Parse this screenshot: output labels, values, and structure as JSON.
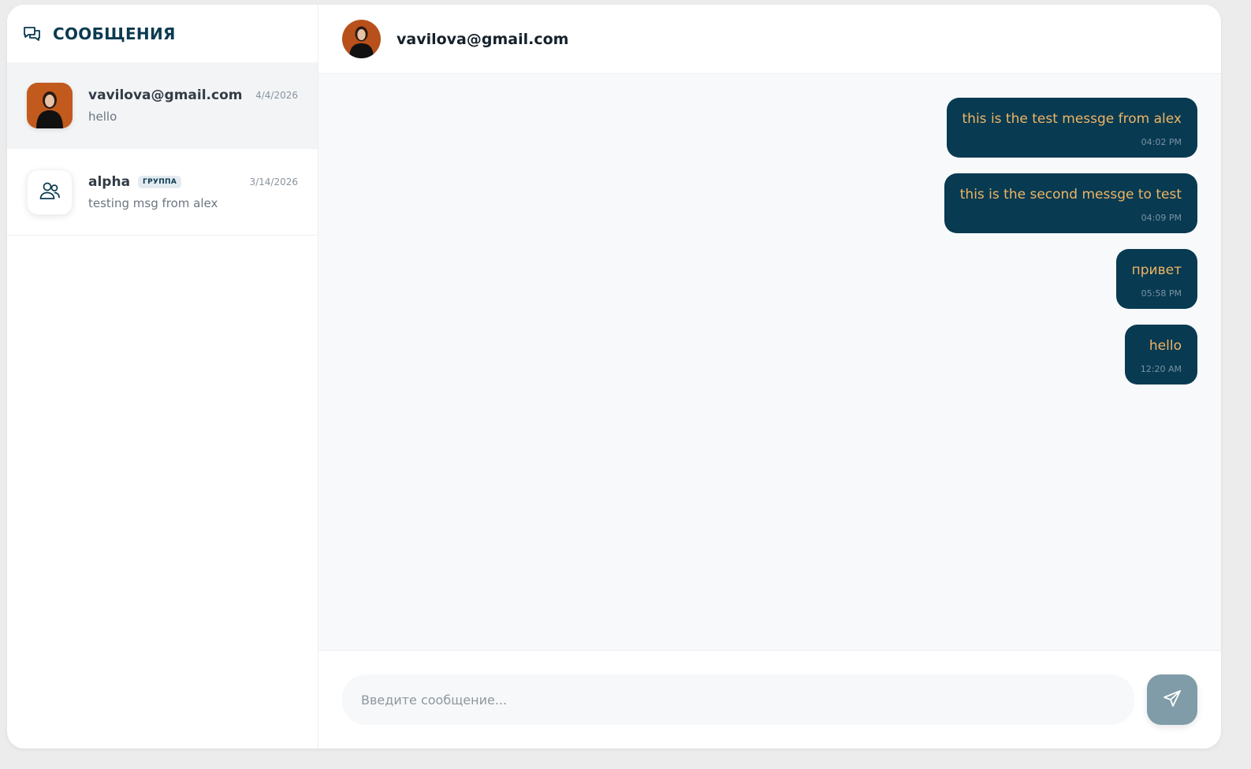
{
  "sidebar": {
    "title": "СООБЩЕНИЯ",
    "conversations": [
      {
        "name": "vavilova@gmail.com",
        "date": "4/4/2026",
        "preview": "hello",
        "active": true
      },
      {
        "name": "alpha",
        "badge": "ГРУППА",
        "date": "3/14/2026",
        "preview": "testing msg from alex",
        "active": false
      }
    ]
  },
  "chat": {
    "title": "vavilova@gmail.com",
    "messages": [
      {
        "text": "this is the test messge from alex",
        "time": "04:02 PM"
      },
      {
        "text": "this is the second messge to test",
        "time": "04:09 PM"
      },
      {
        "text": "привет",
        "time": "05:58 PM"
      },
      {
        "text": "hello",
        "time": "12:20 AM"
      }
    ]
  },
  "composer": {
    "placeholder": "Введите сообщение..."
  },
  "colors": {
    "primary": "#083a52",
    "message_text": "#f0b563",
    "send_button": "#7f9ca8"
  }
}
